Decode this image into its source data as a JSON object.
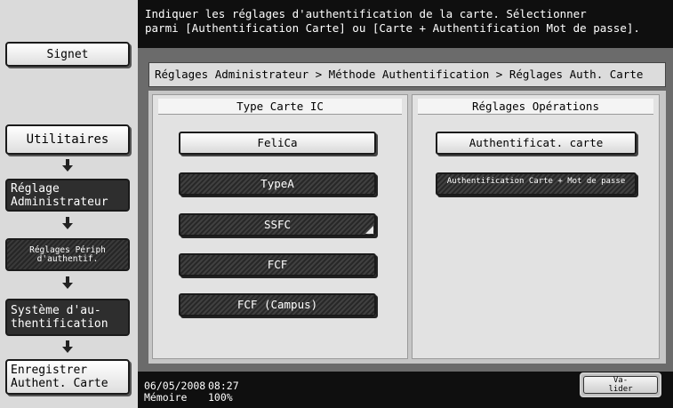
{
  "left_nav": {
    "bookmark_label": "Signet",
    "utilities_label": "Utilitaires",
    "steps": [
      "Réglage Administrateur",
      "Réglages Périph d'authentif.",
      "Système d'au-thentification",
      "Enregistrer Authent. Carte"
    ]
  },
  "message": {
    "line1": "Indiquer les réglages d'authentification de la carte. Sélectionner",
    "line2": "parmi [Authentification Carte] ou [Carte + Authentification Mot de passe]."
  },
  "breadcrumb": "Réglages Administrateur > Méthode Authentification > Réglages Auth. Carte",
  "ic_card_panel": {
    "title": "Type Carte IC",
    "options": [
      "FeliCa",
      "TypeA",
      "SSFC",
      "FCF",
      "FCF (Campus)"
    ],
    "selected": "FeliCa"
  },
  "operations_panel": {
    "title": "Réglages Opérations",
    "options": [
      "Authentificat. carte",
      "Authentification Carte + Mot de passe"
    ],
    "selected": "Authentificat. carte"
  },
  "status": {
    "date": "06/05/2008",
    "time": "08:27",
    "memory_label": "Mémoire",
    "memory_value": "100%"
  },
  "ok_button": {
    "line1": "Va-",
    "line2": "lider"
  }
}
